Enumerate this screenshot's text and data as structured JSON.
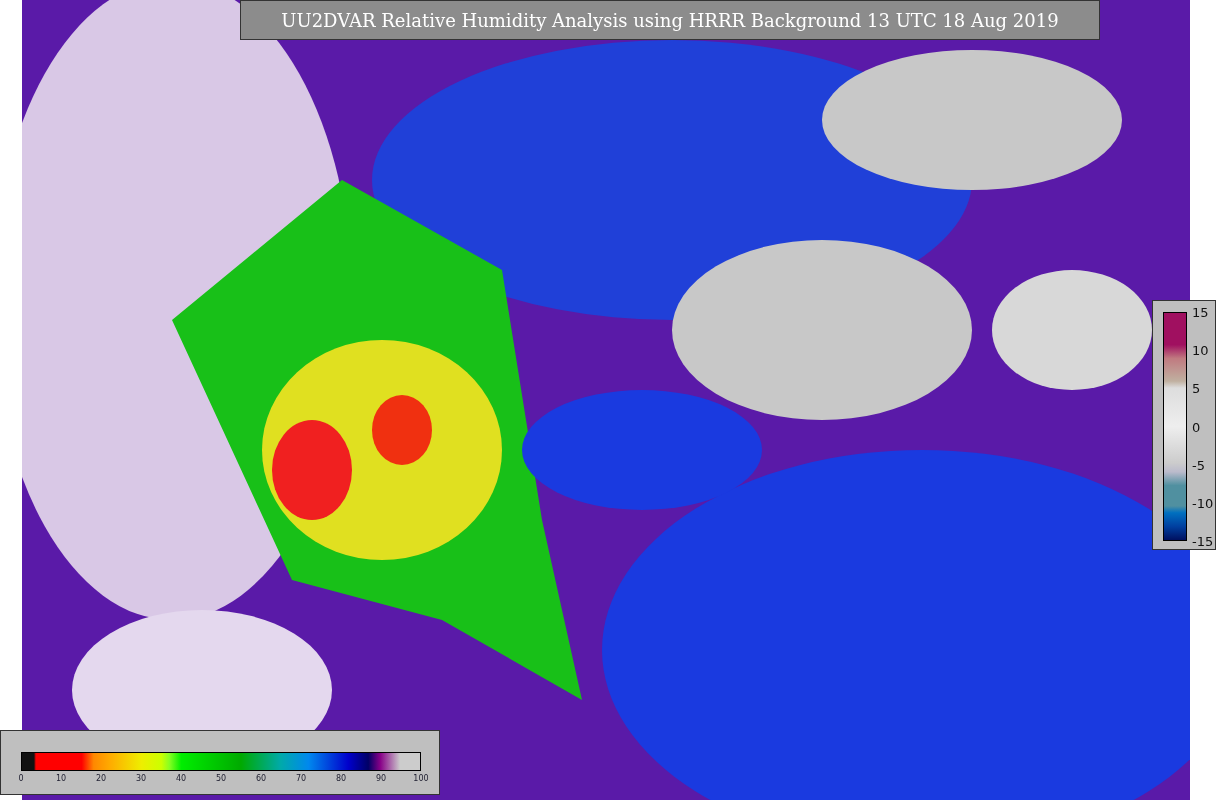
{
  "title": "UU2DVAR Relative Humidity Analysis using HRRR Background 13 UTC 18 Aug 2019",
  "humidity_colorbar": {
    "ticks": [
      "0",
      "10",
      "20",
      "30",
      "40",
      "50",
      "60",
      "70",
      "80",
      "90",
      "100"
    ]
  },
  "difference_colorbar": {
    "ticks": [
      "15",
      "10",
      "5",
      "0",
      "-5",
      "-10",
      "-15"
    ]
  }
}
